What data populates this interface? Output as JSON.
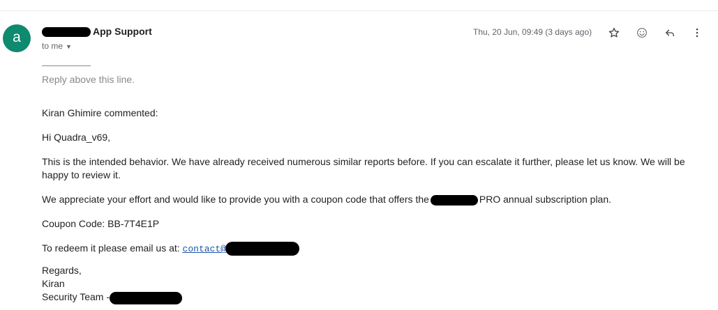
{
  "sender": {
    "avatar_letter": "a",
    "avatar_color": "#0e8a6e",
    "name_visible": "App Support",
    "recipient_label": "to me",
    "date": "Thu, 20 Jun, 09:49 (3 days ago)"
  },
  "toolbar": {
    "star_icon": "star-outline-icon",
    "emoji_icon": "emoji-smile-icon",
    "reply_icon": "reply-icon",
    "more_icon": "more-vertical-icon"
  },
  "body": {
    "reply_above": "Reply above this line.",
    "commented": "Kiran Ghimire commented:",
    "greeting": "Hi Quadra_v69,",
    "para1": "This is the intended behavior. We have already received numerous similar reports before. If you can escalate it further, please let us know. We will be happy to review it.",
    "para2_before": "We appreciate your effort and would like to provide you with a coupon code that offers the",
    "para2_after": "PRO annual subscription plan.",
    "coupon": "Coupon Code: BB-7T4E1P",
    "redeem_prefix": "To redeem it please email us at:",
    "redeem_link": "contact@",
    "regards": "Regards,",
    "signer": "Kiran",
    "team_prefix": "Security Team -"
  },
  "colors": {
    "link": "#1a55a6",
    "muted": "#5f6368",
    "redaction": "#000000"
  }
}
